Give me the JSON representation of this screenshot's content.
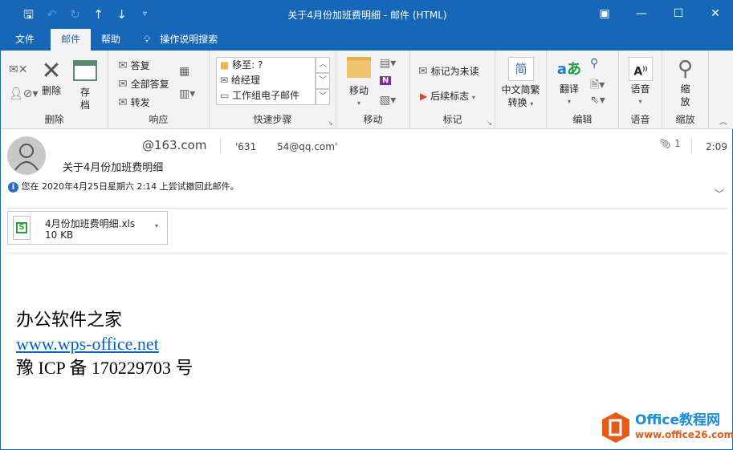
{
  "window": {
    "title": "关于4月份加班费明细  -  邮件 (HTML)"
  },
  "tabs": [
    {
      "label": "文件"
    },
    {
      "label": "邮件"
    },
    {
      "label": "帮助"
    },
    {
      "label": "操作说明搜索"
    }
  ],
  "ribbon": {
    "delete_group": {
      "label": "删除",
      "delete": "删除",
      "archive": "存档"
    },
    "respond_group": {
      "label": "响应",
      "reply": "答复",
      "reply_all": "全部答复",
      "forward": "转发"
    },
    "quick_steps": {
      "label": "快速步骤",
      "items": [
        "移至: ?",
        "给经理",
        "工作组电子邮件"
      ]
    },
    "move_group": {
      "label": "移动",
      "move": "移动"
    },
    "tags_group": {
      "label": "标记",
      "mark_unread": "标记为未读",
      "follow_up": "后续标志"
    },
    "chinese_conv": {
      "label": "中文简繁转换",
      "line1": "中文简繁",
      "line2": "转换",
      "icon_char": "简"
    },
    "editing_group": {
      "label": "编辑",
      "translate": "翻译"
    },
    "speech_group": {
      "label": "语音",
      "speech": "语音"
    },
    "zoom_group": {
      "label": "缩放",
      "zoom_l1": "缩",
      "zoom_l2": "放"
    }
  },
  "message": {
    "from": "@163.com",
    "to_a": "'631",
    "to_b": "54@qq.com'",
    "subject": "关于4月份加班费明细",
    "attachment_count": "1",
    "time": "2:09",
    "info": "您在 2020年4月25日星期六 2:14 上尝试撤回此邮件。",
    "attachment": {
      "name": "4月份加班费明细.xls",
      "size": "10 KB"
    }
  },
  "body": {
    "line1": "办公软件之家",
    "link": "www.wps-office.net",
    "line3": "豫 ICP 备 170229703 号"
  },
  "watermark": {
    "brand": "Office教程网",
    "url": "www.office26.com"
  }
}
